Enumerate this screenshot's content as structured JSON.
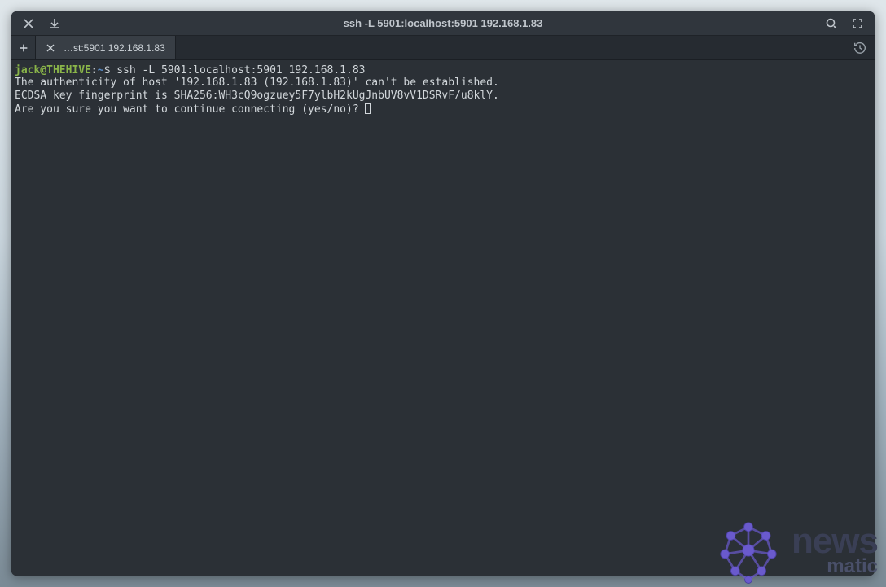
{
  "window": {
    "title": "ssh -L 5901:localhost:5901 192.168.1.83"
  },
  "titlebar_icons": {
    "close": "close-icon",
    "download": "download-icon",
    "search": "search-icon",
    "fullscreen": "fullscreen-icon"
  },
  "tabs": {
    "newtab": "plus-icon",
    "items": [
      {
        "label": "…st:5901 192.168.1.83"
      }
    ],
    "history_icon": "history-icon"
  },
  "terminal": {
    "prompt": {
      "userhost": "jack@THEHIVE",
      "sep": ":",
      "path": "~",
      "symbol": "$"
    },
    "command": "ssh -L 5901:localhost:5901 192.168.1.83",
    "lines": [
      "The authenticity of host '192.168.1.83 (192.168.1.83)' can't be established.",
      "ECDSA key fingerprint is SHA256:WH3cQ9ogzuey5F7ylbH2kUgJnbUV8vV1DSRvF/u8klY.",
      "Are you sure you want to continue connecting (yes/no)? "
    ]
  },
  "watermark": {
    "top": "news",
    "bottom": "matic"
  },
  "colors": {
    "bg": "#2b3036",
    "prompt_user": "#8ab549",
    "prompt_path": "#5a8cc7",
    "text": "#d2d7db"
  }
}
